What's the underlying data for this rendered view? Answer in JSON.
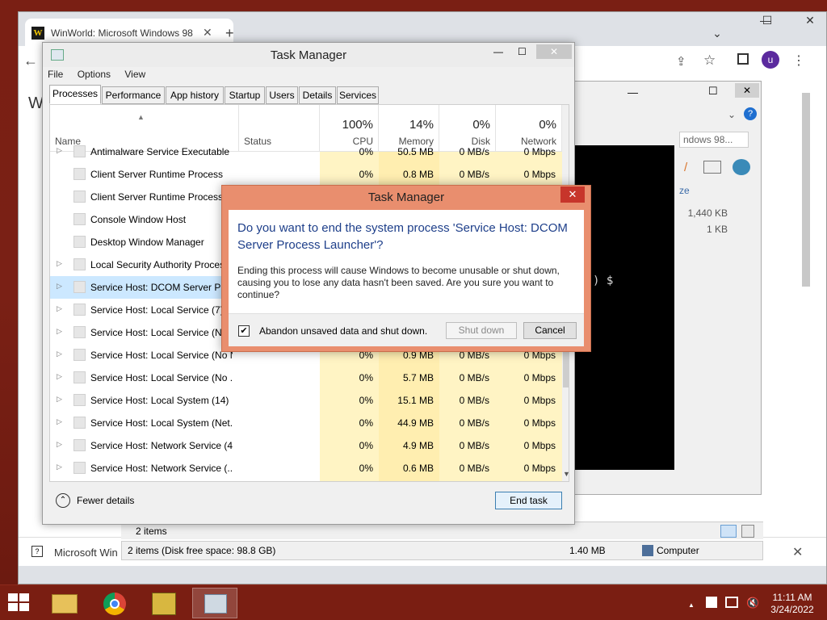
{
  "chrome": {
    "tab_title": "WinWorld: Microsoft Windows 98",
    "tab_close": "✕",
    "new_tab": "+",
    "profile_initial": "u",
    "page_partial_heading": "W",
    "bottom_text": "Microsoft Win",
    "bottom_close": "✕"
  },
  "explorer": {
    "search_partial": "ndows 98...",
    "size_header": "ze",
    "size_1": "1,440 KB",
    "size_2": "1 KB",
    "console_prompt": ") $",
    "status_items": "2 items",
    "status_disk": "2 items (Disk free space: 98.8 GB)",
    "status_size": "1.40 MB",
    "status_location": "Computer"
  },
  "task_manager": {
    "title": "Task Manager",
    "menu": [
      "File",
      "Options",
      "View"
    ],
    "tabs": [
      "Processes",
      "Performance",
      "App history",
      "Startup",
      "Users",
      "Details",
      "Services"
    ],
    "columns": {
      "name": "Name",
      "status": "Status",
      "cpu_pct": "100%",
      "cpu": "CPU",
      "mem_pct": "14%",
      "mem": "Memory",
      "disk_pct": "0%",
      "disk": "Disk",
      "net_pct": "0%",
      "net": "Network"
    },
    "rows": [
      {
        "name": "Antimalware Service Executable",
        "cpu": "0%",
        "mem": "50.5 MB",
        "disk": "0 MB/s",
        "net": "0 Mbps",
        "expand": "▷"
      },
      {
        "name": "Client Server Runtime Process",
        "cpu": "0%",
        "mem": "0.8 MB",
        "disk": "0 MB/s",
        "net": "0 Mbps",
        "expand": ""
      },
      {
        "name": "Client Server Runtime Process",
        "cpu": "",
        "mem": "",
        "disk": "",
        "net": "",
        "expand": ""
      },
      {
        "name": "Console Window Host",
        "cpu": "",
        "mem": "",
        "disk": "",
        "net": "",
        "expand": ""
      },
      {
        "name": "Desktop Window Manager",
        "cpu": "",
        "mem": "",
        "disk": "",
        "net": "",
        "expand": ""
      },
      {
        "name": "Local Security Authority Process",
        "cpu": "",
        "mem": "",
        "disk": "",
        "net": "",
        "expand": "▷"
      },
      {
        "name": "Service Host: DCOM Server Process Launcher",
        "cpu": "",
        "mem": "",
        "disk": "",
        "net": "",
        "expand": "▷"
      },
      {
        "name": "Service Host: Local Service (7)",
        "cpu": "",
        "mem": "",
        "disk": "",
        "net": "",
        "expand": "▷"
      },
      {
        "name": "Service Host: Local Service (Network Restricted)",
        "cpu": "",
        "mem": "",
        "disk": "",
        "net": "",
        "expand": "▷"
      },
      {
        "name": "Service Host: Local Service (No Network)",
        "cpu": "0%",
        "mem": "0.9 MB",
        "disk": "0 MB/s",
        "net": "0 Mbps",
        "expand": "▷"
      },
      {
        "name": "Service Host: Local Service (No ...",
        "cpu": "0%",
        "mem": "5.7 MB",
        "disk": "0 MB/s",
        "net": "0 Mbps",
        "expand": "▷"
      },
      {
        "name": "Service Host: Local System (14)",
        "cpu": "0%",
        "mem": "15.1 MB",
        "disk": "0 MB/s",
        "net": "0 Mbps",
        "expand": "▷"
      },
      {
        "name": "Service Host: Local System (Net...",
        "cpu": "0%",
        "mem": "44.9 MB",
        "disk": "0 MB/s",
        "net": "0 Mbps",
        "expand": "▷"
      },
      {
        "name": "Service Host: Network Service (4)",
        "cpu": "0%",
        "mem": "4.9 MB",
        "disk": "0 MB/s",
        "net": "0 Mbps",
        "expand": "▷"
      },
      {
        "name": "Service Host: Network Service (...",
        "cpu": "0%",
        "mem": "0.6 MB",
        "disk": "0 MB/s",
        "net": "0 Mbps",
        "expand": "▷"
      }
    ],
    "fewer_details": "Fewer details",
    "end_task": "End task"
  },
  "dialog": {
    "title": "Task Manager",
    "close": "✕",
    "heading": "Do you want to end the system process 'Service Host: DCOM Server Process Launcher'?",
    "body": "Ending this process will cause Windows to become unusable or shut down, causing you to lose any data hasn't been saved. Are you sure you want to continue?",
    "checkbox_label": "Abandon unsaved data and shut down.",
    "checkbox_checked": "✔",
    "shutdown": "Shut down",
    "cancel": "Cancel"
  },
  "taskbar": {
    "time": "11:11 AM",
    "date": "3/24/2022",
    "tray_arrow": "▲"
  },
  "colors": {
    "dialog_frame": "#e98e6e",
    "dialog_heading": "#1e3f8a",
    "cpu_column": "#fff4c4",
    "desktop": "#7a1f14"
  }
}
